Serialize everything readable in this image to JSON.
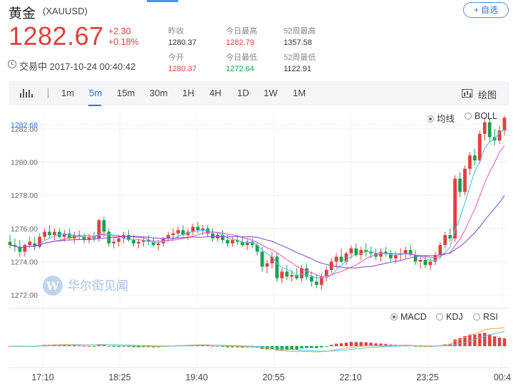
{
  "header": {
    "name": "黄金",
    "symbol": "(XAUUSD)",
    "watch_label": "+ 自选",
    "price": "1282.67",
    "change_abs": "+2.30",
    "change_pct": "+0.18%",
    "status": "交易中 2017-10-24 00:40:42"
  },
  "stats": {
    "prev_close_label": "昨收",
    "prev_close": "1280.37",
    "open_label": "今开",
    "open": "1280.37",
    "high_label": "今日最高",
    "high": "1282.79",
    "low_label": "今日最低",
    "low": "1272.64",
    "w52_high_label": "52周最高",
    "w52_high": "1357.58",
    "w52_low_label": "52周最低",
    "w52_low": "1122.91"
  },
  "toolbar": {
    "tabs": [
      "1m",
      "5m",
      "15m",
      "30m",
      "1H",
      "4H",
      "1D",
      "1W",
      "1M"
    ],
    "active_tab": "5m",
    "draw_label": "绘图"
  },
  "indicators": {
    "main_options": [
      "均线",
      "BOLL"
    ],
    "main_selected": "均线",
    "sub_options": [
      "MACD",
      "KDJ",
      "RSI"
    ],
    "sub_selected": "MACD"
  },
  "watermark": "华尔街见闻",
  "colors": {
    "up": "#e0403f",
    "down": "#1aa050",
    "accent": "#2f6fd6",
    "ma5": "#50c4e0",
    "ma10": "#e55fc2",
    "ma20": "#8a4fd0"
  },
  "chart_data": {
    "type": "candlestick",
    "yticks": [
      "1282.00",
      "1280.00",
      "1278.00",
      "1276.00",
      "1274.00",
      "1272.00"
    ],
    "ylim": [
      1271.4,
      1282.9
    ],
    "current_price_label": "1282.68",
    "xticks": [
      "17:10",
      "18:25",
      "19:40",
      "20:55",
      "22:10",
      "23:25",
      "00:4"
    ],
    "grid": true,
    "candles": [
      [
        1275.2,
        1275.6,
        1274.8,
        1275.0
      ],
      [
        1275.0,
        1275.4,
        1274.6,
        1274.9
      ],
      [
        1274.9,
        1275.3,
        1274.3,
        1274.6
      ],
      [
        1274.6,
        1275.1,
        1274.3,
        1275.0
      ],
      [
        1275.0,
        1275.5,
        1274.8,
        1275.2
      ],
      [
        1275.1,
        1275.5,
        1274.7,
        1274.9
      ],
      [
        1274.9,
        1275.7,
        1274.8,
        1275.5
      ],
      [
        1275.5,
        1276.0,
        1275.3,
        1275.8
      ],
      [
        1275.8,
        1276.2,
        1275.4,
        1275.6
      ],
      [
        1275.6,
        1276.0,
        1275.3,
        1275.8
      ],
      [
        1275.8,
        1276.0,
        1275.4,
        1275.5
      ],
      [
        1275.5,
        1275.9,
        1275.2,
        1275.7
      ],
      [
        1275.7,
        1276.0,
        1275.3,
        1275.4
      ],
      [
        1275.4,
        1275.8,
        1275.1,
        1275.6
      ],
      [
        1275.6,
        1275.9,
        1275.3,
        1275.5
      ],
      [
        1275.5,
        1275.7,
        1275.1,
        1275.3
      ],
      [
        1275.3,
        1275.7,
        1275.1,
        1275.5
      ],
      [
        1275.5,
        1275.8,
        1275.2,
        1275.4
      ],
      [
        1275.4,
        1276.6,
        1275.2,
        1276.5
      ],
      [
        1276.5,
        1276.7,
        1275.5,
        1275.8
      ],
      [
        1275.8,
        1276.0,
        1274.9,
        1275.1
      ],
      [
        1275.1,
        1275.4,
        1274.8,
        1275.2
      ],
      [
        1275.2,
        1275.6,
        1274.9,
        1275.4
      ],
      [
        1275.4,
        1275.8,
        1275.1,
        1275.6
      ],
      [
        1275.6,
        1275.9,
        1275.2,
        1275.3
      ],
      [
        1275.3,
        1275.6,
        1274.9,
        1275.1
      ],
      [
        1275.1,
        1275.4,
        1274.8,
        1275.2
      ],
      [
        1275.2,
        1275.5,
        1274.9,
        1275.3
      ],
      [
        1275.3,
        1275.6,
        1275.0,
        1275.2
      ],
      [
        1275.2,
        1275.4,
        1274.9,
        1275.0
      ],
      [
        1275.0,
        1275.3,
        1274.7,
        1275.1
      ],
      [
        1275.1,
        1275.5,
        1274.9,
        1275.4
      ],
      [
        1275.4,
        1275.8,
        1275.2,
        1275.6
      ],
      [
        1275.6,
        1276.0,
        1275.3,
        1275.7
      ],
      [
        1275.7,
        1276.1,
        1275.4,
        1275.9
      ],
      [
        1275.9,
        1276.2,
        1275.5,
        1275.6
      ],
      [
        1275.6,
        1276.0,
        1275.3,
        1275.8
      ],
      [
        1275.8,
        1276.3,
        1275.6,
        1276.1
      ],
      [
        1276.1,
        1276.4,
        1275.7,
        1275.9
      ],
      [
        1275.9,
        1276.2,
        1275.6,
        1276.0
      ],
      [
        1276.0,
        1276.2,
        1275.5,
        1275.7
      ],
      [
        1275.7,
        1276.0,
        1275.2,
        1275.4
      ],
      [
        1275.4,
        1275.8,
        1275.2,
        1275.6
      ],
      [
        1275.6,
        1275.9,
        1275.1,
        1275.3
      ],
      [
        1275.3,
        1275.6,
        1274.9,
        1275.1
      ],
      [
        1275.1,
        1275.5,
        1274.9,
        1275.3
      ],
      [
        1275.3,
        1275.6,
        1275.0,
        1275.2
      ],
      [
        1275.2,
        1275.5,
        1274.9,
        1275.0
      ],
      [
        1275.0,
        1275.4,
        1274.7,
        1275.2
      ],
      [
        1275.2,
        1275.4,
        1274.8,
        1275.0
      ],
      [
        1275.0,
        1275.2,
        1274.4,
        1274.6
      ],
      [
        1274.6,
        1274.9,
        1273.4,
        1273.7
      ],
      [
        1273.7,
        1274.1,
        1273.3,
        1273.9
      ],
      [
        1273.9,
        1274.6,
        1273.6,
        1274.3
      ],
      [
        1274.3,
        1274.5,
        1272.8,
        1273.0
      ],
      [
        1273.0,
        1273.6,
        1272.7,
        1273.4
      ],
      [
        1273.4,
        1273.8,
        1272.9,
        1273.1
      ],
      [
        1273.1,
        1273.5,
        1272.8,
        1273.2
      ],
      [
        1273.2,
        1273.6,
        1272.9,
        1273.0
      ],
      [
        1273.0,
        1273.8,
        1272.8,
        1273.6
      ],
      [
        1273.6,
        1273.9,
        1272.9,
        1273.1
      ],
      [
        1273.1,
        1273.4,
        1272.5,
        1272.8
      ],
      [
        1272.8,
        1273.2,
        1272.4,
        1272.6
      ],
      [
        1272.6,
        1273.3,
        1272.3,
        1273.1
      ],
      [
        1273.1,
        1273.7,
        1272.8,
        1273.5
      ],
      [
        1273.5,
        1274.2,
        1273.3,
        1274.0
      ],
      [
        1274.0,
        1274.5,
        1273.6,
        1274.3
      ],
      [
        1274.3,
        1274.8,
        1273.9,
        1274.0
      ],
      [
        1274.0,
        1274.6,
        1273.8,
        1274.5
      ],
      [
        1274.5,
        1275.0,
        1274.2,
        1274.8
      ],
      [
        1274.8,
        1275.1,
        1274.3,
        1274.4
      ],
      [
        1274.4,
        1274.9,
        1274.1,
        1274.7
      ],
      [
        1274.7,
        1275.1,
        1274.3,
        1274.6
      ],
      [
        1274.6,
        1274.9,
        1274.2,
        1274.5
      ],
      [
        1274.5,
        1274.8,
        1274.1,
        1274.3
      ],
      [
        1274.3,
        1274.8,
        1274.0,
        1274.6
      ],
      [
        1274.6,
        1274.9,
        1274.3,
        1274.5
      ],
      [
        1274.5,
        1274.7,
        1274.0,
        1274.2
      ],
      [
        1274.2,
        1274.6,
        1273.9,
        1274.4
      ],
      [
        1274.4,
        1274.8,
        1274.1,
        1274.5
      ],
      [
        1274.5,
        1274.9,
        1274.2,
        1274.7
      ],
      [
        1274.7,
        1275.0,
        1274.3,
        1274.4
      ],
      [
        1274.4,
        1274.7,
        1273.8,
        1274.0
      ],
      [
        1274.0,
        1274.3,
        1273.6,
        1274.1
      ],
      [
        1274.1,
        1274.3,
        1273.6,
        1273.8
      ],
      [
        1273.8,
        1274.2,
        1273.5,
        1274.0
      ],
      [
        1274.0,
        1274.6,
        1273.8,
        1274.4
      ],
      [
        1274.4,
        1275.2,
        1274.2,
        1275.0
      ],
      [
        1275.0,
        1275.8,
        1274.8,
        1275.6
      ],
      [
        1275.6,
        1276.0,
        1275.2,
        1275.4
      ],
      [
        1275.4,
        1279.2,
        1275.2,
        1279.0
      ],
      [
        1279.0,
        1279.4,
        1277.9,
        1278.2
      ],
      [
        1278.2,
        1279.8,
        1278.0,
        1279.6
      ],
      [
        1279.6,
        1280.6,
        1279.2,
        1280.4
      ],
      [
        1280.4,
        1280.8,
        1279.8,
        1280.1
      ],
      [
        1280.1,
        1281.9,
        1279.9,
        1281.7
      ],
      [
        1281.7,
        1282.7,
        1281.3,
        1282.4
      ],
      [
        1282.4,
        1282.6,
        1281.2,
        1281.5
      ],
      [
        1281.5,
        1282.0,
        1281.0,
        1281.3
      ],
      [
        1281.3,
        1282.2,
        1281.1,
        1281.9
      ],
      [
        1281.9,
        1282.79,
        1281.6,
        1282.67
      ]
    ]
  }
}
